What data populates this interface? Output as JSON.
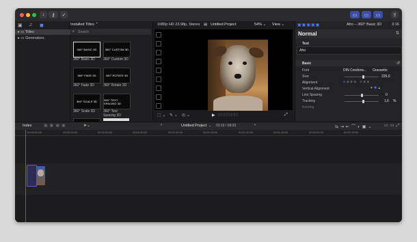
{
  "colors": {
    "accent": "#3a6ef0",
    "playhead": "#d33a2c",
    "clip_border": "#7b4fd6"
  },
  "toolbar": {
    "icons": [
      "arrow-down-icon",
      "key-icon",
      "check-circle-icon",
      "layout-icon",
      "share-icon"
    ]
  },
  "browser": {
    "header": "Installed Titles ⌃",
    "search_placeholder": "Search",
    "categories": [
      {
        "label": "Titles",
        "selected": true
      },
      {
        "label": "Generators",
        "selected": false
      }
    ],
    "titles": [
      {
        "thumb": "360° BASIC 3D",
        "caption": "360° Basic 3D"
      },
      {
        "thumb": "360° CUSTOM 3D",
        "caption": "360° Custom 3D"
      },
      {
        "thumb": "360° FADE 3D",
        "caption": "360° Fade 3D"
      },
      {
        "thumb": "360° ROTATE 3D",
        "caption": "360° Rotate 3D"
      },
      {
        "thumb": "360° SCALE 3D",
        "caption": "360° Scale 3D"
      },
      {
        "thumb": "360° TEXT SPACING 3D",
        "caption": "360° Text Spacing 3D"
      }
    ]
  },
  "viewer": {
    "format": "1080p HD 23.98p, Stereo",
    "project": "Untitled Project",
    "zoom": "54%",
    "view": "View"
  },
  "inspector": {
    "title": "Afro – 360° Basic 3D",
    "duration": "3:16",
    "heading": "Normal",
    "text_section": "Text",
    "text_value": "Afro",
    "basic_section": "Basic",
    "font_label": "Font",
    "font_value": "DIN Condens...",
    "font_style": "Grassetto",
    "size_label": "Size",
    "size_value": "225,0",
    "alignment_label": "Alignment",
    "valign_label": "Vertical Alignment",
    "line_spacing_label": "Line Spacing",
    "line_spacing_value": "0",
    "tracking_label": "Tracking",
    "tracking_value": "1,6",
    "tracking_unit": "%",
    "kerning_label": "Kerning"
  },
  "timeline": {
    "index_label": "Index",
    "project_name": "Untitled Project",
    "timecode": "03:16 / 08:03",
    "ruler": [
      "00:00:00:00",
      "00:00:15:00",
      "00:00:30:00",
      "00:00:45:00",
      "00:01:00:00",
      "00:01:15:00",
      "00:01:30:00",
      "00:01:45:00",
      "00:02:00:00",
      "00:02:15:00"
    ]
  }
}
